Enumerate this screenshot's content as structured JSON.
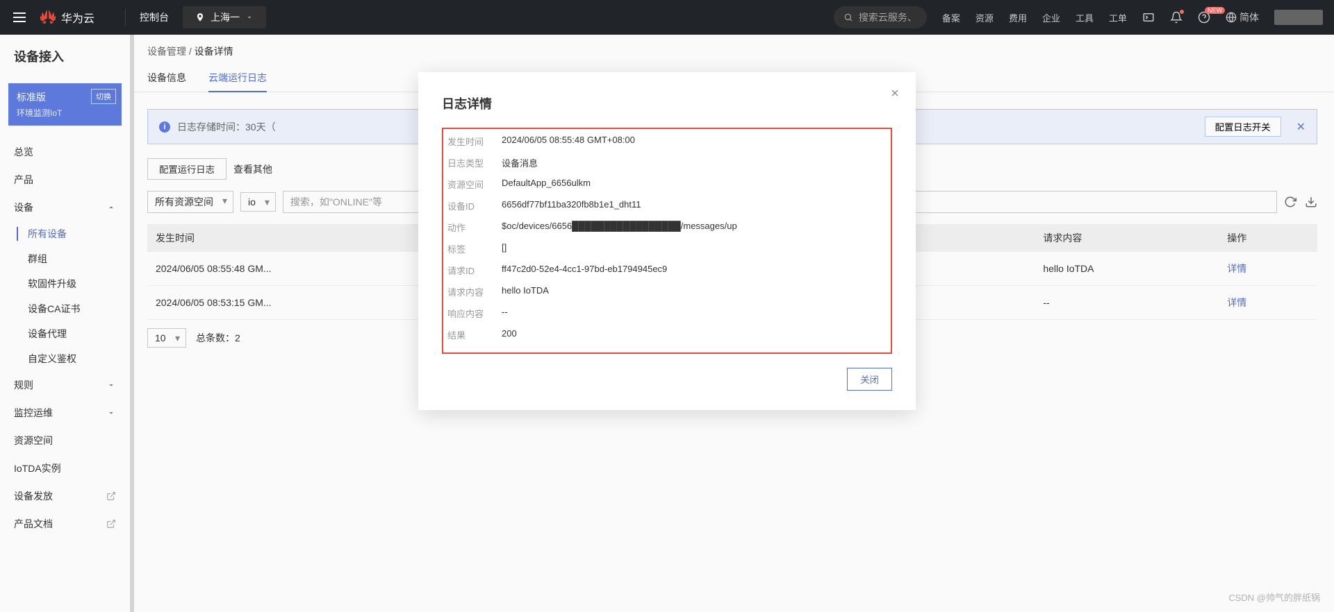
{
  "topbar": {
    "brand": "华为云",
    "console": "控制台",
    "region": "上海一",
    "search_placeholder": "搜索云服务、",
    "links": [
      "备案",
      "资源",
      "费用",
      "企业",
      "工具",
      "工单"
    ],
    "new_badge": "NEW",
    "language": "简体"
  },
  "sidebar": {
    "title": "设备接入",
    "plan": {
      "name": "标准版",
      "sub": "环境监测IoT",
      "switch": "切换"
    },
    "items": [
      {
        "label": "总览"
      },
      {
        "label": "产品"
      },
      {
        "label": "设备",
        "expandable": true,
        "expanded": true,
        "children": [
          {
            "label": "所有设备",
            "active": true
          },
          {
            "label": "群组"
          },
          {
            "label": "软固件升级"
          },
          {
            "label": "设备CA证书"
          },
          {
            "label": "设备代理"
          },
          {
            "label": "自定义鉴权"
          }
        ]
      },
      {
        "label": "规则",
        "expandable": true
      },
      {
        "label": "监控运维",
        "expandable": true
      },
      {
        "label": "资源空间"
      },
      {
        "label": "IoTDA实例"
      },
      {
        "label": "设备发放",
        "external": true
      },
      {
        "label": "产品文档",
        "external": true
      }
    ]
  },
  "breadcrumb": {
    "parent": "设备管理",
    "current": "设备详情"
  },
  "tabs": [
    {
      "label": "设备信息"
    },
    {
      "label": "云端运行日志",
      "active": true
    }
  ],
  "banner": {
    "text_prefix": "日志存储时间：30天（",
    "config_btn": "配置日志开关"
  },
  "toolbar": {
    "config_run": "配置运行日志",
    "view_other": "查看其他",
    "resource_space": "所有资源空间",
    "io_short": "io",
    "search_placeholder": "搜索，如\"ONLINE\"等"
  },
  "table": {
    "headers": {
      "time": "发生时间",
      "request": "请求内容",
      "op": "操作"
    },
    "rows": [
      {
        "time": "2024/06/05 08:55:48 GM...",
        "request": "hello IoTDA",
        "op": "详情"
      },
      {
        "time": "2024/06/05 08:53:15 GM...",
        "request": "--",
        "op": "详情"
      }
    ],
    "page_size": "10",
    "total_label": "总条数：",
    "total": "2"
  },
  "modal": {
    "title": "日志详情",
    "close_btn": "关闭",
    "rows": [
      {
        "k": "发生时间",
        "v": "2024/06/05 08:55:48 GMT+08:00"
      },
      {
        "k": "日志类型",
        "v": "设备消息"
      },
      {
        "k": "资源空间",
        "v": "DefaultApp_6656ulkm"
      },
      {
        "k": "设备ID",
        "v": "6656df77bf11ba320fb8b1e1_dht11"
      },
      {
        "k": "动作",
        "v": "$oc/devices/6656█████████████████/messages/up"
      },
      {
        "k": "标签",
        "v": "[]"
      },
      {
        "k": "请求ID",
        "v": "ff47c2d0-52e4-4cc1-97bd-eb1794945ec9"
      },
      {
        "k": "请求内容",
        "v": "hello IoTDA"
      },
      {
        "k": "响应内容",
        "v": "--"
      },
      {
        "k": "结果",
        "v": "200"
      }
    ]
  },
  "cite": "CSDN @帅气的胖纸锅"
}
